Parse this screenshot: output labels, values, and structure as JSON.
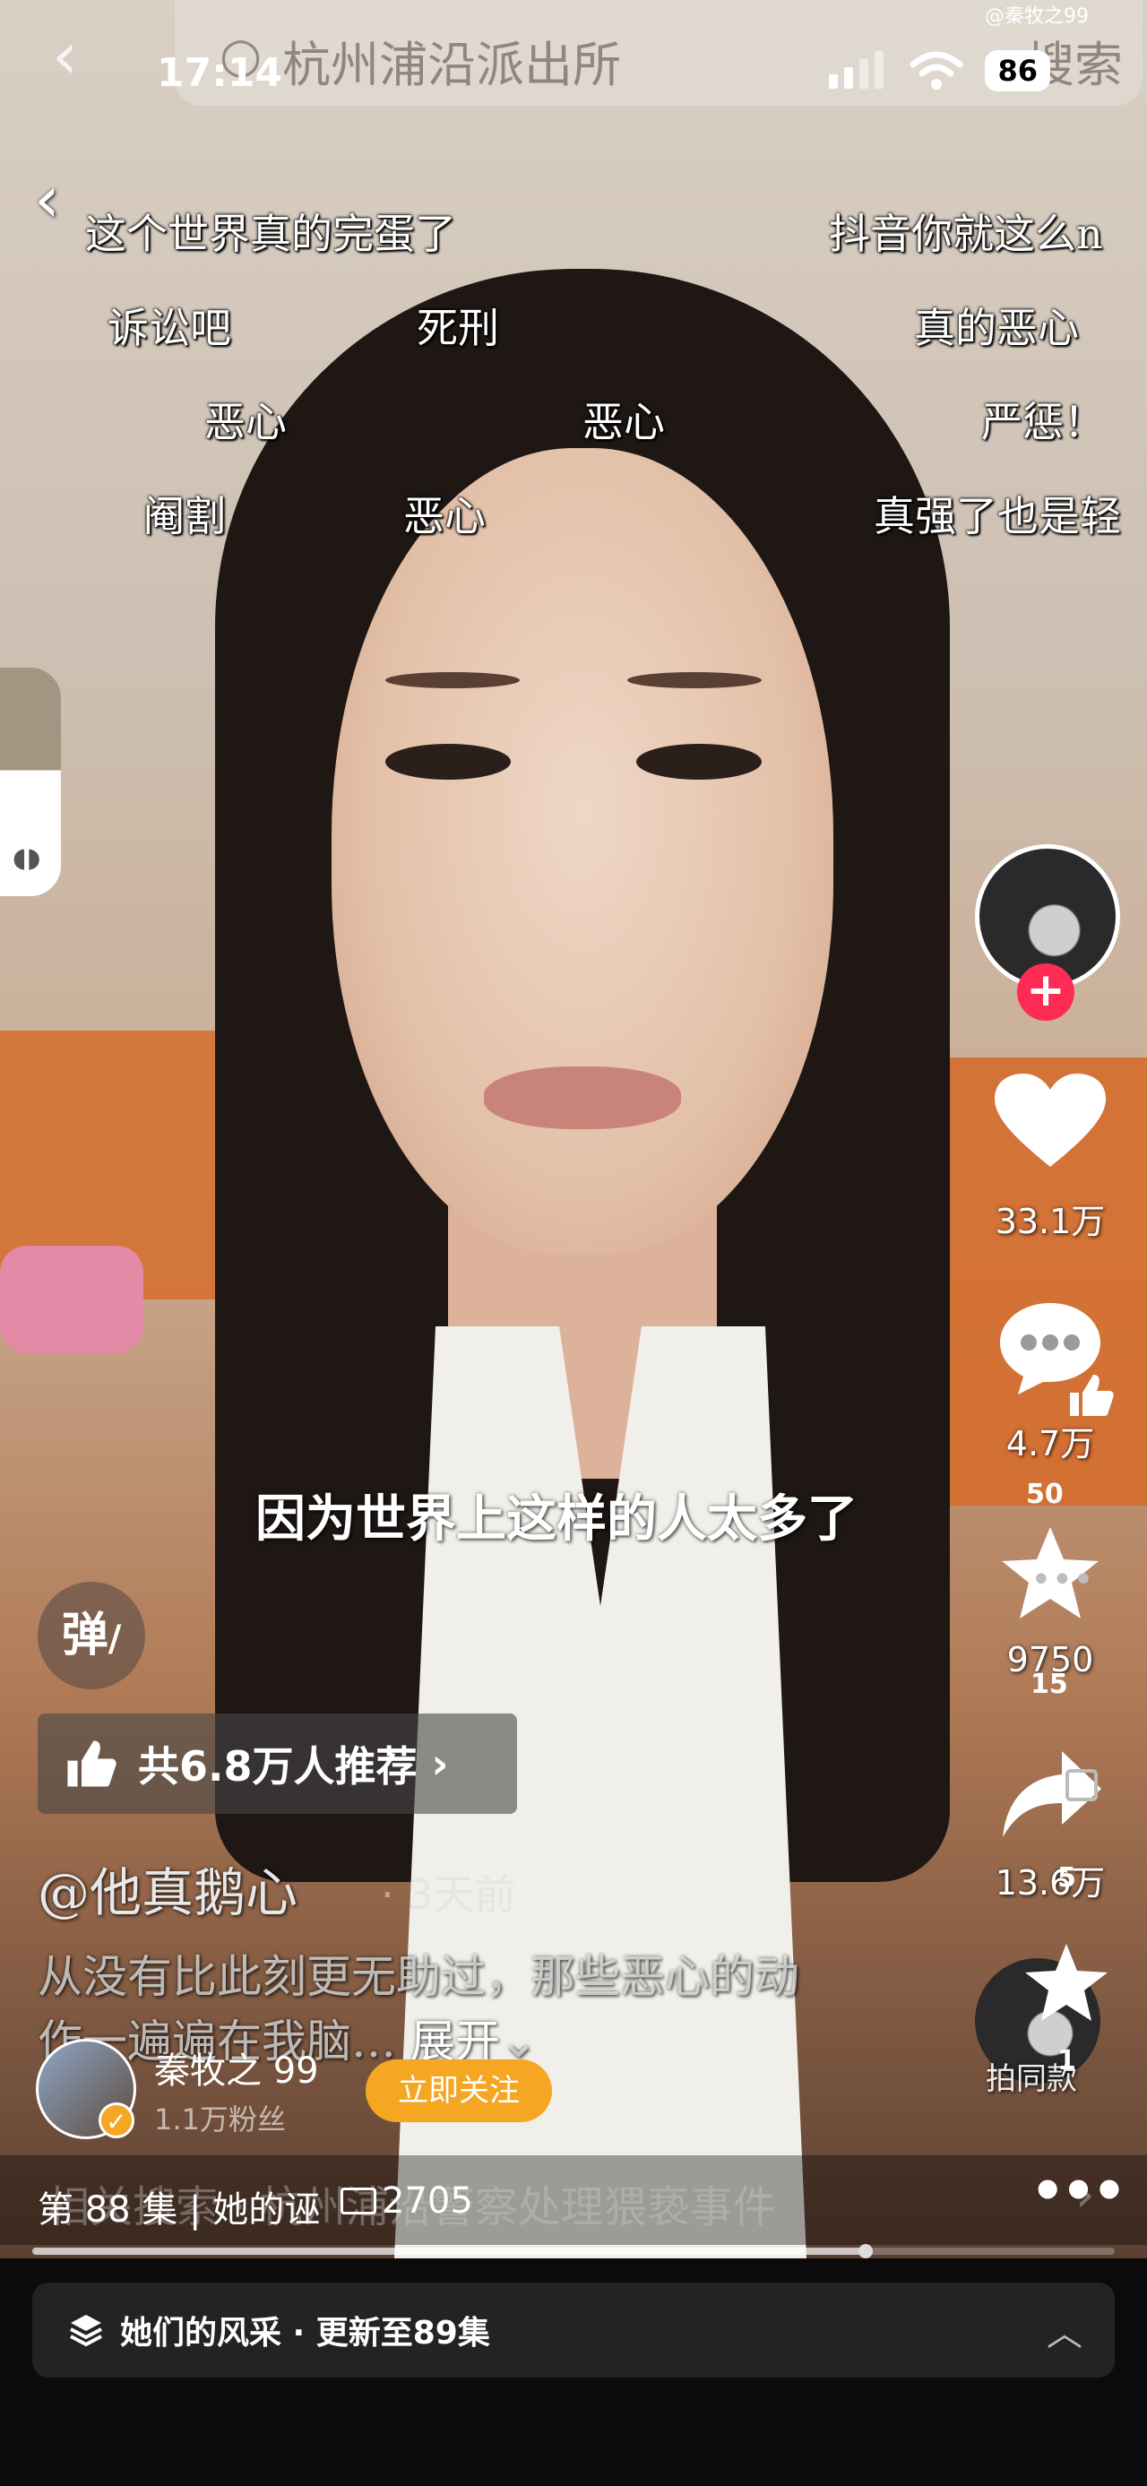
{
  "status_bar": {
    "time": "17:14",
    "battery": "86",
    "watermark": "@秦牧之99"
  },
  "top_search": {
    "text": "杭州浦沿派出所",
    "button": "搜索"
  },
  "danmu": [
    "这个世界真的完蛋了",
    "抖音你就这么n",
    "诉讼吧",
    "死刑",
    "真的恶心",
    "恶心",
    "恶心",
    "严惩！",
    "阉割",
    "恶心",
    "真强了也是轻"
  ],
  "subtitle": "因为世界上这样的人太多了",
  "right_rail": {
    "likes": "33.1万",
    "comments": "4.7万",
    "comments_overlap": "50",
    "favorites": "9750",
    "favorites_overlap": "15",
    "shares": "13.6万",
    "shares_overlap": "5",
    "same_style": "拍同款",
    "same_style_overlap": "1"
  },
  "danmu_toggle": "弹",
  "recommend": {
    "label": "共6.8万人推荐"
  },
  "post": {
    "author": "@他真鹅心",
    "time": "3天前",
    "caption": "从没有比此刻更无助过，那些恶心的动作一遍遍在我脑…",
    "expand": "展开"
  },
  "creator": {
    "name": "秦牧之 99",
    "fans": "1.1万粉丝",
    "follow": "立即关注"
  },
  "related_search": "相关搜索 · 杭州浦沿警察处理猥亵事件",
  "episode": {
    "label": "第 88 集 | 她的诬",
    "views": "2705"
  },
  "progress": {
    "played_fraction": 0.77
  },
  "series": {
    "title": "她们的风采 · 更新至89集"
  },
  "colors": {
    "accent_red": "#fe2c55",
    "follow_orange": "#f5a623"
  }
}
